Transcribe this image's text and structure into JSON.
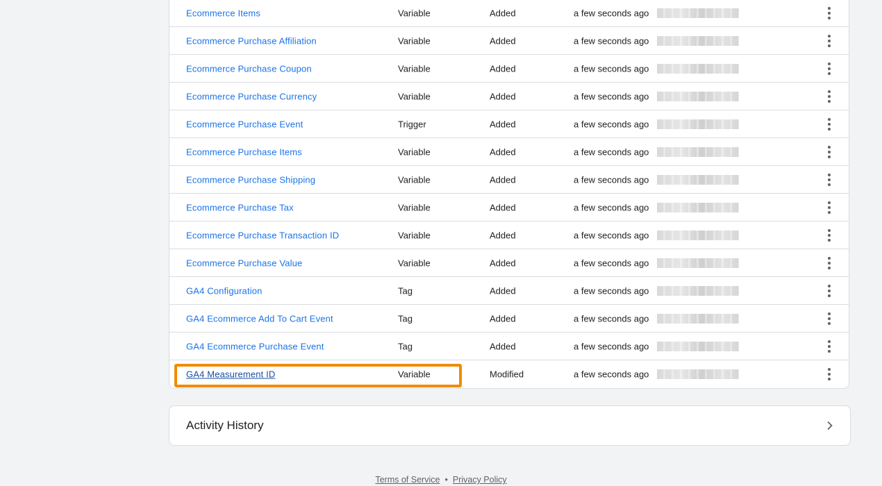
{
  "changes": {
    "rows": [
      {
        "name": "Ecommerce Items",
        "type": "Variable",
        "change": "Added",
        "time": "a few seconds ago"
      },
      {
        "name": "Ecommerce Purchase Affiliation",
        "type": "Variable",
        "change": "Added",
        "time": "a few seconds ago"
      },
      {
        "name": "Ecommerce Purchase Coupon",
        "type": "Variable",
        "change": "Added",
        "time": "a few seconds ago"
      },
      {
        "name": "Ecommerce Purchase Currency",
        "type": "Variable",
        "change": "Added",
        "time": "a few seconds ago"
      },
      {
        "name": "Ecommerce Purchase Event",
        "type": "Trigger",
        "change": "Added",
        "time": "a few seconds ago"
      },
      {
        "name": "Ecommerce Purchase Items",
        "type": "Variable",
        "change": "Added",
        "time": "a few seconds ago"
      },
      {
        "name": "Ecommerce Purchase Shipping",
        "type": "Variable",
        "change": "Added",
        "time": "a few seconds ago"
      },
      {
        "name": "Ecommerce Purchase Tax",
        "type": "Variable",
        "change": "Added",
        "time": "a few seconds ago"
      },
      {
        "name": "Ecommerce Purchase Transaction ID",
        "type": "Variable",
        "change": "Added",
        "time": "a few seconds ago"
      },
      {
        "name": "Ecommerce Purchase Value",
        "type": "Variable",
        "change": "Added",
        "time": "a few seconds ago"
      },
      {
        "name": "GA4 Configuration",
        "type": "Tag",
        "change": "Added",
        "time": "a few seconds ago"
      },
      {
        "name": "GA4 Ecommerce Add To Cart Event",
        "type": "Tag",
        "change": "Added",
        "time": "a few seconds ago"
      },
      {
        "name": "GA4 Ecommerce Purchase Event",
        "type": "Tag",
        "change": "Added",
        "time": "a few seconds ago"
      },
      {
        "name": "GA4 Measurement ID",
        "type": "Variable",
        "change": "Modified",
        "time": "a few seconds ago"
      }
    ],
    "row_menu_icon": "more-vert-icon",
    "user_cell": "redacted-blur"
  },
  "activity_history": {
    "title": "Activity History",
    "icon": "chevron-right-icon"
  },
  "footer": {
    "terms": "Terms of Service",
    "separator": "•",
    "privacy": "Privacy Policy"
  },
  "colors": {
    "link": "#1a73e8",
    "highlight": "#f28b00",
    "background": "#f1f3f4"
  }
}
